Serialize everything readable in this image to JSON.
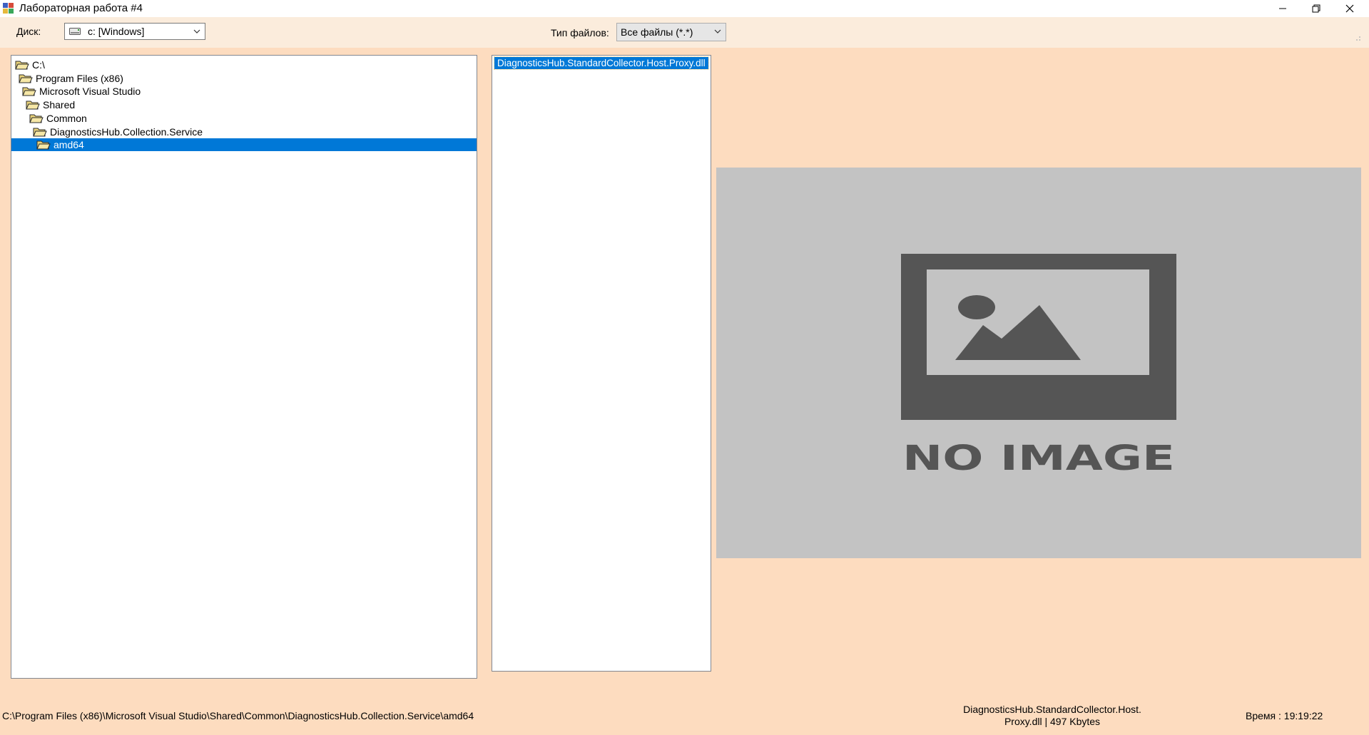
{
  "window": {
    "title": "Лабораторная работа #4",
    "icons": {
      "app": "app-icon",
      "minimize": "minimize-icon",
      "maximize": "restore-icon",
      "close": "close-icon"
    }
  },
  "toolbar": {
    "disk_label": "Диск:",
    "disk_value": "c: [Windows]",
    "filetype_label": "Тип файлов:",
    "filetype_value": "Все файлы  (*.*)"
  },
  "tree": {
    "nodes": [
      {
        "label": "C:\\",
        "depth": 0,
        "selected": false
      },
      {
        "label": "Program Files (x86)",
        "depth": 1,
        "selected": false
      },
      {
        "label": "Microsoft Visual Studio",
        "depth": 2,
        "selected": false
      },
      {
        "label": "Shared",
        "depth": 3,
        "selected": false
      },
      {
        "label": "Common",
        "depth": 4,
        "selected": false
      },
      {
        "label": "DiagnosticsHub.Collection.Service",
        "depth": 5,
        "selected": false
      },
      {
        "label": "amd64",
        "depth": 6,
        "selected": true
      }
    ]
  },
  "files": {
    "items": [
      "DiagnosticsHub.StandardCollector.Host.Proxy.dll"
    ]
  },
  "preview": {
    "text": "NO IMAGE",
    "icon": "image-placeholder-icon"
  },
  "status": {
    "path": "C:\\Program Files (x86)\\Microsoft Visual Studio\\Shared\\Common\\DiagnosticsHub.Collection.Service\\amd64",
    "file_line1": "DiagnosticsHub.StandardCollector.Host.",
    "file_line2": "Proxy.dll  |  497 Kbytes",
    "time": "Время :  19:19:22"
  },
  "colors": {
    "background": "#fddcbf",
    "toolbar": "#fbecdc",
    "selection": "#0078d7",
    "preview_bg": "#c3c3c3",
    "preview_fg": "#555555"
  }
}
